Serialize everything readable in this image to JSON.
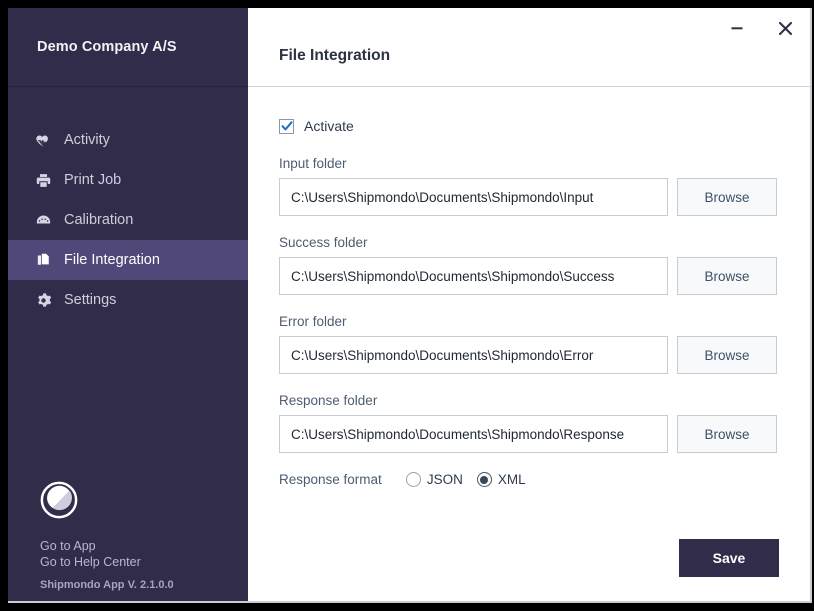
{
  "sidebar": {
    "company_name": "Demo Company A/S",
    "items": [
      {
        "label": "Activity",
        "icon": "heart-pulse-icon",
        "active": false
      },
      {
        "label": "Print Job",
        "icon": "printer-icon",
        "active": false
      },
      {
        "label": "Calibration",
        "icon": "gauge-icon",
        "active": false
      },
      {
        "label": "File Integration",
        "icon": "files-icon",
        "active": true
      },
      {
        "label": "Settings",
        "icon": "gear-icon",
        "active": false
      }
    ],
    "footer": {
      "logo_icon": "shipmondo-logo-icon",
      "go_to_app": "Go to App",
      "go_to_help_center": "Go to Help Center",
      "version": "Shipmondo App V. 2.1.0.0"
    }
  },
  "header": {
    "title": "File Integration",
    "minimize_icon": "minimize-icon",
    "close_icon": "close-icon"
  },
  "form": {
    "activate": {
      "label": "Activate",
      "checked": true,
      "check_icon": "checkmark-icon"
    },
    "fields": [
      {
        "label": "Input folder",
        "value": "C:\\Users\\Shipmondo\\Documents\\Shipmondo\\Input",
        "placeholder": "",
        "browse_label": "Browse"
      },
      {
        "label": "Success folder",
        "value": "C:\\Users\\Shipmondo\\Documents\\Shipmondo\\Success",
        "placeholder": "",
        "browse_label": "Browse"
      },
      {
        "label": "Error folder",
        "value": "C:\\Users\\Shipmondo\\Documents\\Shipmondo\\Error",
        "placeholder": "",
        "browse_label": "Browse"
      },
      {
        "label": "Response folder",
        "value": "C:\\Users\\Shipmondo\\Documents\\Shipmondo\\Response",
        "placeholder": "",
        "browse_label": "Browse"
      }
    ],
    "response_format": {
      "label": "Response format",
      "options": [
        {
          "label": "JSON",
          "selected": false
        },
        {
          "label": "XML",
          "selected": true
        }
      ]
    },
    "save_label": "Save"
  },
  "colors": {
    "sidebar_bg": "#322c4b",
    "sidebar_active": "#504878",
    "accent_check": "#1b6ec2",
    "save_bg": "#322c4b",
    "label_text": "#4e5c70"
  }
}
